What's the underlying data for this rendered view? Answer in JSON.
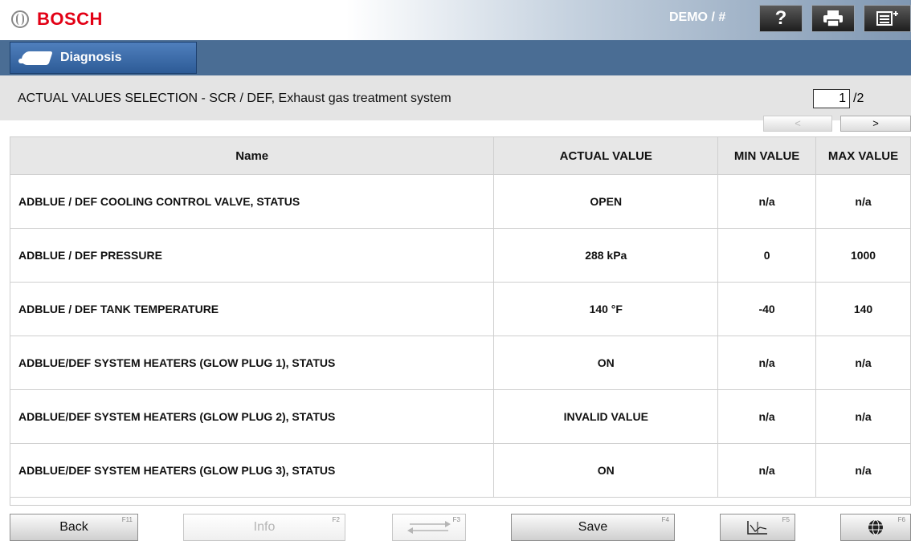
{
  "header": {
    "brand": "BOSCH",
    "demo_label": "DEMO / #",
    "help_glyph": "?"
  },
  "nav": {
    "diagnosis_label": "Diagnosis"
  },
  "titlebar": {
    "title": "ACTUAL VALUES SELECTION - SCR / DEF, Exhaust gas treatment system",
    "page_current": "1",
    "page_total": "/2",
    "prev_label": "<",
    "next_label": ">"
  },
  "table": {
    "headers": {
      "name": "Name",
      "actual": "ACTUAL VALUE",
      "min": "MIN VALUE",
      "max": "MAX VALUE"
    },
    "rows": [
      {
        "name": "ADBLUE / DEF COOLING CONTROL VALVE, STATUS",
        "actual": "OPEN",
        "min": "n/a",
        "max": "n/a"
      },
      {
        "name": "ADBLUE / DEF PRESSURE",
        "actual": "288 kPa",
        "min": "0",
        "max": "1000"
      },
      {
        "name": "ADBLUE / DEF TANK TEMPERATURE",
        "actual": "140 °F",
        "min": "-40",
        "max": "140"
      },
      {
        "name": "ADBLUE/DEF SYSTEM HEATERS (GLOW PLUG 1), STATUS",
        "actual": "ON",
        "min": "n/a",
        "max": "n/a"
      },
      {
        "name": "ADBLUE/DEF SYSTEM HEATERS (GLOW PLUG 2), STATUS",
        "actual": "INVALID VALUE",
        "min": "n/a",
        "max": "n/a"
      },
      {
        "name": "ADBLUE/DEF SYSTEM HEATERS (GLOW PLUG 3), STATUS",
        "actual": "ON",
        "min": "n/a",
        "max": "n/a"
      }
    ]
  },
  "footer": {
    "back_label": "Back",
    "back_key": "F11",
    "info_label": "Info",
    "info_key": "F2",
    "f3_key": "F3",
    "save_label": "Save",
    "save_key": "F4",
    "f5_key": "F5",
    "f6_key": "F6"
  },
  "icons": {
    "help": "question-icon",
    "print": "printer-icon",
    "menu": "menu-icon",
    "diagnosis": "car-icon",
    "transfer": "arrows-exchange-icon",
    "graph": "graph-icon",
    "globe": "globe-icon"
  },
  "colors": {
    "brand_red": "#e20015",
    "nav_blue": "#4a6d94",
    "tab_blue": "#3a6aa8"
  }
}
